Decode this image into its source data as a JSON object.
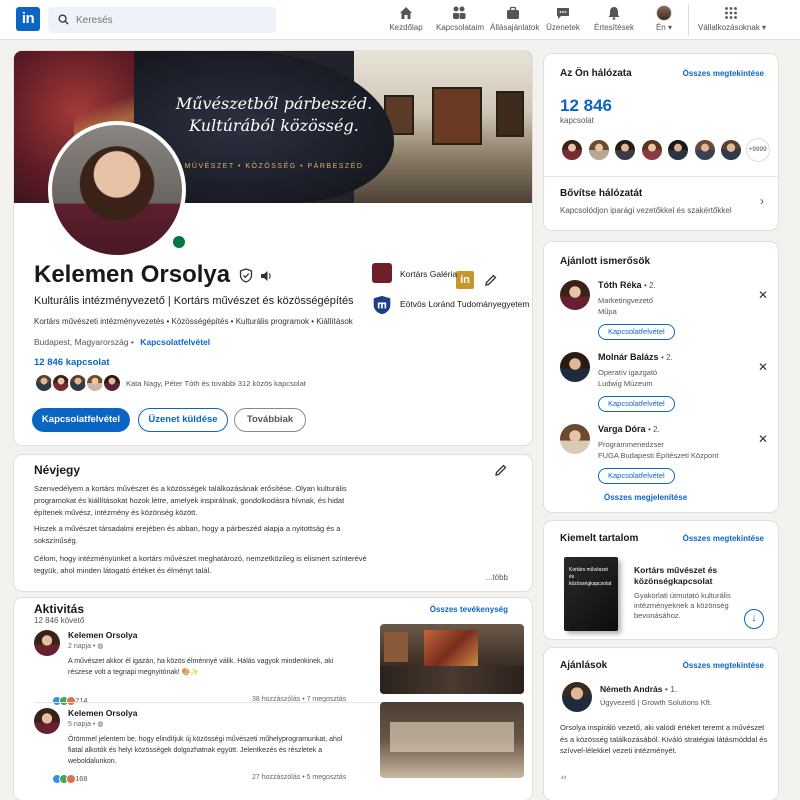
{
  "nav": {
    "logo": "in",
    "search_placeholder": "Keresés",
    "items": [
      {
        "label": "Kezdőlap",
        "icon": "home-icon"
      },
      {
        "label": "Kapcsolataim",
        "icon": "network-icon"
      },
      {
        "label": "Állásajánlatok",
        "icon": "briefcase-icon"
      },
      {
        "label": "Üzenetek",
        "icon": "message-icon"
      },
      {
        "label": "Értesítések",
        "icon": "bell-icon"
      },
      {
        "label": "Én",
        "icon": "avatar"
      },
      {
        "label": "Vállalkozásoknak",
        "icon": "grid-icon"
      }
    ]
  },
  "banner": {
    "line1": "Művészetből párbeszéd.",
    "line2": "Kultúrából közösség.",
    "tagline": "MŰVÉSZET  •  KÖZÖSSÉG  •  PÁRBESZÉD"
  },
  "profile": {
    "name": "Kelemen Orsolya",
    "headline": "Kulturális intézményvezető | Kortárs művészet és közösségépítés",
    "tags": "Kortárs művészeti intézményvezetés  •  Közösségépítés  •  Kulturális programok  •  Kiállítások",
    "location": "Budapest, Magyarország",
    "contact_link": "Kapcsolatfelvétel",
    "connections": "12 846 kapcsolat",
    "mutual_text": "Kata Nagy, Péter Tóth és további 312 közös kapcsolat",
    "buttons": {
      "connect": "Kapcsolatfelvétel",
      "message": "Üzenet küldése",
      "more": "Továbbiak"
    },
    "orgs": [
      {
        "name": "Kortárs Galéria"
      },
      {
        "name": "Eötvös Loránd Tudományegyetem"
      }
    ]
  },
  "about": {
    "title": "Névjegy",
    "paragraphs": [
      "Szenvedélyem a kortárs művészet és a közösségek találkozásának erősítése. Olyan kulturális programokat és kiállításokat hozok létre, amelyek inspirálnak, gondolkodásra hívnak, és hidat építenek művész, intézmény és közönség között.",
      "Hiszek a művészet társadalmi erejében és abban, hogy a párbeszéd alapja a nyitottság és a sokszínűség.",
      "Célom, hogy intézményünket a kortárs művészet meghatározó, nemzetközileg is elismert színterévé tegyük, ahol minden látogató értéket és élményt talál."
    ],
    "more": "...több"
  },
  "activity": {
    "title": "Aktivitás",
    "followers": "12 846 követő",
    "all_link": "Összes tevékenység",
    "posts": [
      {
        "author": "Kelemen Orsolya",
        "time": "2 napja  •",
        "text": "A művészet akkor él igazán, ha közös élménnyé válik. Hálás vagyok mindenkinek, aki részese volt a tegnapi megnyitónak! 🎨✨",
        "reactions": "214",
        "stats": "38 hozzászólás  •  7 megosztás"
      },
      {
        "author": "Kelemen Orsolya",
        "time": "5 napja  •",
        "text": "Örömmel jelentem be, hogy elindítjuk új közösségi művészeti műhelyprogramunkat, ahol fiatal alkotók és helyi közösségek dolgozhatnak együtt. Jelentkezés és részletek a weboldalunkon.",
        "reactions": "168",
        "stats": "27 hozzászólás  •  5 megosztás"
      }
    ]
  },
  "network": {
    "title": "Az Ön hálózata",
    "link": "Összes megtekintése",
    "count": "12 846",
    "count_label": "kapcsolat",
    "more_badge": "+9999",
    "grow_title": "Bővítse hálózatát",
    "grow_sub": "Kapcsolódjon iparági vezetőkkel és szakértőkkel"
  },
  "suggestions": {
    "title": "Ajánlott ismerősök",
    "items": [
      {
        "name": "Tóth Réka",
        "degree": "• 2.",
        "line1": "Marketingvezető",
        "line2": "Műpa",
        "button": "Kapcsolatfelvétel"
      },
      {
        "name": "Molnár Balázs",
        "degree": "• 2.",
        "line1": "Operatív igazgató",
        "line2": "Ludwig Múzeum",
        "button": "Kapcsolatfelvétel"
      },
      {
        "name": "Varga Dóra",
        "degree": "• 2.",
        "line1": "Programmenedzser",
        "line2": "FUGA Budapesti Építészeti Központ",
        "button": "Kapcsolatfelvétel"
      }
    ],
    "show_all": "Összes megjelenítése"
  },
  "featured": {
    "title": "Kiemelt tartalom",
    "link": "Összes megtekintése",
    "book_cover": "Kortárs művészet és közösségkapcsolat",
    "item_title": "Kortárs művészet és közönségkapcsolat",
    "item_desc": "Gyakorlati útmutató kulturális intézményeknek a közönség bevonásához."
  },
  "recommendations": {
    "title": "Ajánlások",
    "link": "Összes megtekintése",
    "name": "Németh András",
    "degree": "• 1.",
    "role": "Ügyvezető | Growth Solutions Kft.",
    "text": "Orsolya inspiráló vezető, aki valódi értéket teremt a művészet és a közösség találkozásából. Kiváló stratégiai látásmóddal és szívvel-lélekkel vezeti intézményét.",
    "quote_mark": "“"
  },
  "colors": {
    "accent": "#0a66c2",
    "online": "#057642",
    "gold": "#d8b16a"
  }
}
